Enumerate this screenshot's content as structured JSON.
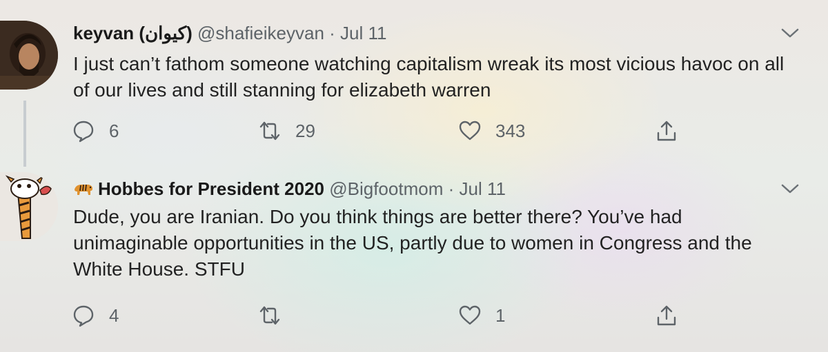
{
  "tweets": [
    {
      "author_name": "keyvan (کیوان)",
      "handle": "@shafieikeyvan",
      "separator": "·",
      "date": "Jul 11",
      "text": "I just can’t fathom someone watching capitalism wreak its most vicious havoc on all of our lives and still stanning for elizabeth warren",
      "replies": "6",
      "retweets": "29",
      "likes": "343",
      "avatar_icon": "user-photo-avatar"
    },
    {
      "author_name": "Hobbes for President 2020",
      "name_emoji_icon": "tiger-icon",
      "handle": "@Bigfootmom",
      "separator": "·",
      "date": "Jul 11",
      "text": "Dude,  you are Iranian.  Do you think things are better there? You’ve had unimaginable opportunities in the US, partly due to women in Congress and the White House. STFU",
      "replies": "4",
      "retweets": "",
      "likes": "1",
      "avatar_icon": "hobbes-cartoon-avatar"
    }
  ],
  "colors": {
    "muted_text": "#5d6368",
    "thread_line": "#c7ccd0"
  }
}
